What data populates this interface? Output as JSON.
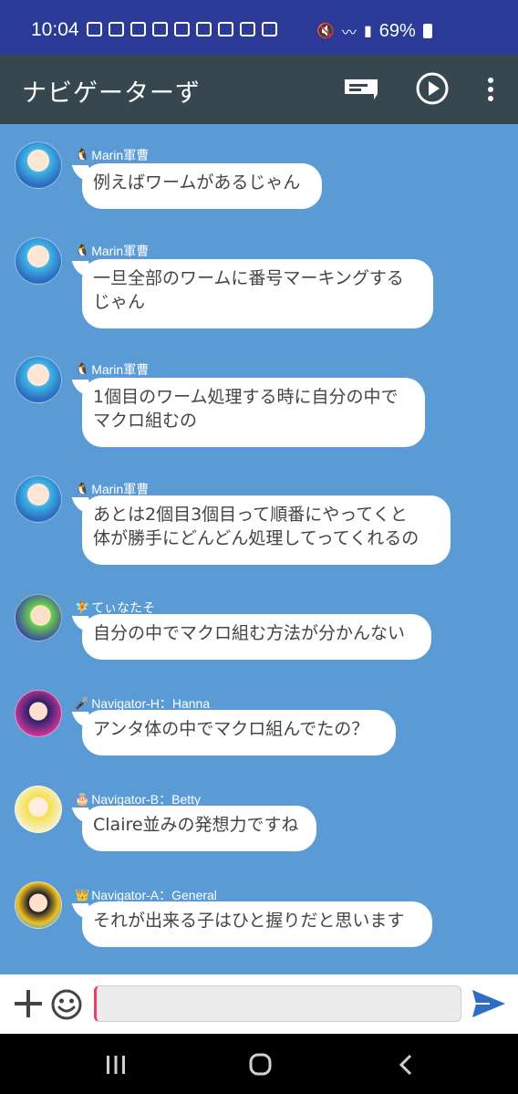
{
  "status_bar": {
    "time": "10:04",
    "battery": "69%"
  },
  "app_bar": {
    "title": "ナビゲーターず"
  },
  "messages": [
    {
      "sender": "Marin軍曹",
      "badge": "🐧",
      "text": "例えばワームがあるじゃん"
    },
    {
      "sender": "Marin軍曹",
      "badge": "🐧",
      "text": "一旦全部のワームに番号マーキングする\nじゃん"
    },
    {
      "sender": "Marin軍曹",
      "badge": "🐧",
      "text": "1個目のワーム処理する時に自分の中で\nマクロ組むの"
    },
    {
      "sender": "Marin軍曹",
      "badge": "🐧",
      "text": "あとは2個目3個目って順番にやってくと\n体が勝手にどんどん処理してってくれるの"
    },
    {
      "sender": "てぃなたそ",
      "badge": "🧚",
      "text": "自分の中でマクロ組む方法が分かんない"
    },
    {
      "sender": "Navigator-H：Hanna",
      "badge": "🎤",
      "text": "アンタ体の中でマクロ組んでたの？"
    },
    {
      "sender": "Navigator-B：Betty",
      "badge": "🎂",
      "text": "Claire並みの発想力ですね"
    },
    {
      "sender": "Navigator-A：General",
      "badge": "👑",
      "text": "それが出来る子はひと握りだと思います"
    }
  ],
  "input": {
    "value": "",
    "placeholder": ""
  },
  "colors": {
    "chat_bg": "#5b9bd5",
    "appbar": "#36474f",
    "statusbar": "#2b3a97",
    "send": "#2f6cc4"
  }
}
